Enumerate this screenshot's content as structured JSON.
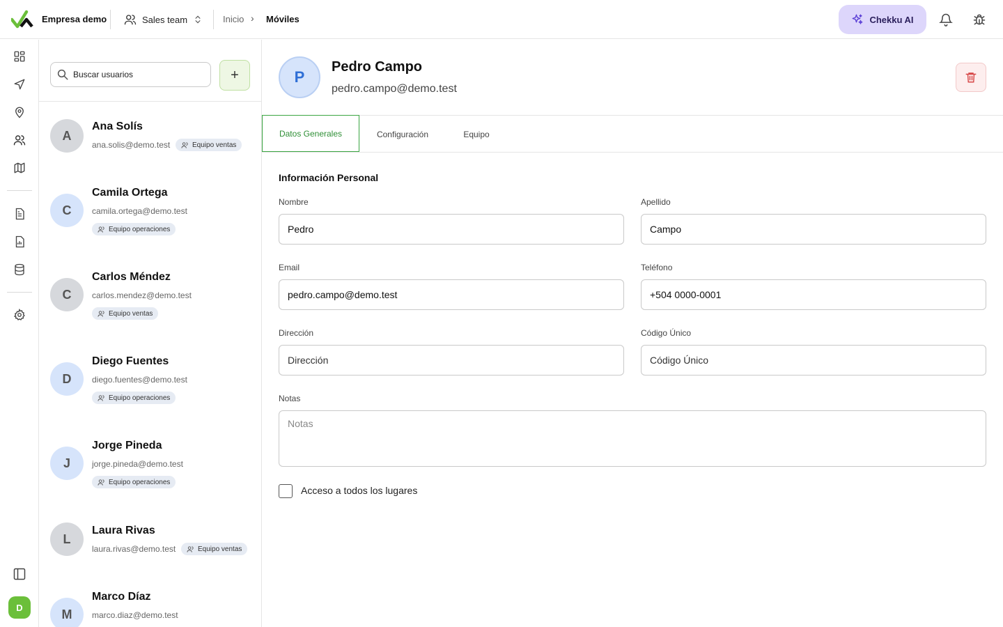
{
  "header": {
    "company": "Empresa demo",
    "team": "Sales team",
    "breadcrumb": {
      "home": "Inicio",
      "separator": "›",
      "current": "Móviles"
    },
    "ai_button": "Chekku AI"
  },
  "search": {
    "placeholder": "Buscar usuarios"
  },
  "add_button": "+",
  "users": [
    {
      "initial": "A",
      "name": "Ana Solís",
      "email": "ana.solis@demo.test",
      "badge": "Equipo ventas"
    },
    {
      "initial": "C",
      "name": "Camila Ortega",
      "email": "camila.ortega@demo.test",
      "badge": "Equipo operaciones"
    },
    {
      "initial": "C",
      "name": "Carlos Méndez",
      "email": "carlos.mendez@demo.test",
      "badge": "Equipo ventas"
    },
    {
      "initial": "D",
      "name": "Diego Fuentes",
      "email": "diego.fuentes@demo.test",
      "badge": "Equipo operaciones"
    },
    {
      "initial": "J",
      "name": "Jorge Pineda",
      "email": "jorge.pineda@demo.test",
      "badge": "Equipo operaciones"
    },
    {
      "initial": "L",
      "name": "Laura Rivas",
      "email": "laura.rivas@demo.test",
      "badge": "Equipo ventas"
    },
    {
      "initial": "M",
      "name": "Marco Díaz",
      "email": "marco.diaz@demo.test"
    }
  ],
  "rail": {
    "avatar_initial": "D"
  },
  "detail": {
    "initial": "P",
    "name": "Pedro Campo",
    "email": "pedro.campo@demo.test",
    "tabs": [
      "Datos Generales",
      "Configuración",
      "Equipo"
    ],
    "section_title": "Información Personal",
    "fields": {
      "nombre": {
        "label": "Nombre",
        "value": "Pedro"
      },
      "apellido": {
        "label": "Apellido",
        "value": "Campo"
      },
      "email": {
        "label": "Email",
        "value": "pedro.campo@demo.test"
      },
      "telefono": {
        "label": "Teléfono",
        "value": "+504 0000-0001"
      },
      "direccion": {
        "label": "Dirección",
        "placeholder": "Dirección"
      },
      "codigo": {
        "label": "Código Único",
        "placeholder": "Código Único"
      },
      "notas": {
        "label": "Notas",
        "placeholder": "Notas"
      }
    },
    "checkbox_label": "Acceso a todos los lugares",
    "checkbox_checked": false
  },
  "colors": {
    "brand_green": "#6bbf3a",
    "ai_purple": "#ddd6fb",
    "active_tab": "#3aa541",
    "danger": "#d64545"
  }
}
